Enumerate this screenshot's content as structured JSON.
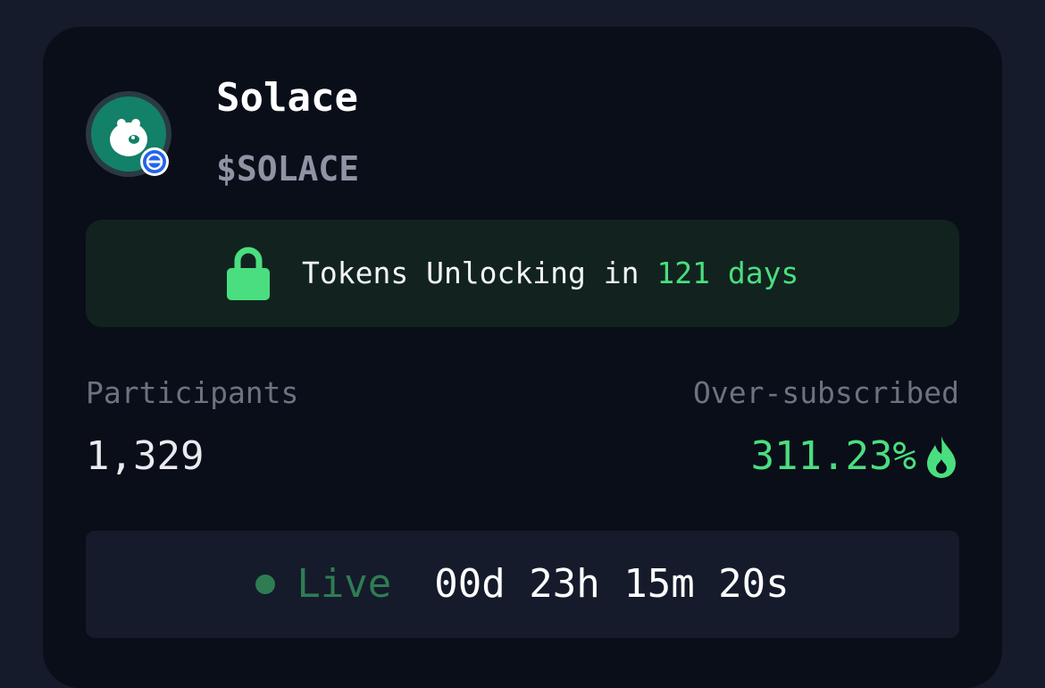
{
  "token": {
    "name": "Solace",
    "symbol": "$SOLACE",
    "logo_icon": "bear-logo-icon",
    "chain_badge_icon": "chain-badge-icon"
  },
  "unlock": {
    "prefix": "Tokens Unlocking in ",
    "days": "121 days",
    "icon": "lock-icon"
  },
  "stats": {
    "participants_label": "Participants",
    "participants_value": "1,329",
    "oversubscribed_label": "Over-subscribed",
    "oversubscribed_value": "311.23%",
    "oversubscribed_icon": "flame-icon"
  },
  "status": {
    "live_label": "Live",
    "countdown": "00d 23h 15m 20s"
  },
  "colors": {
    "background": "#151b2b",
    "card": "#0a0e19",
    "accent_green": "#4ade80",
    "live_green": "#2f7c52",
    "logo_green": "#138068",
    "badge_blue": "#2563eb",
    "muted_text": "#6c7280"
  }
}
